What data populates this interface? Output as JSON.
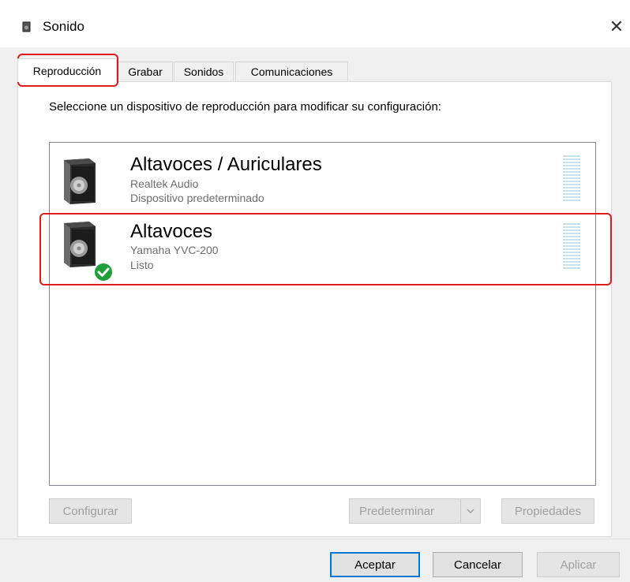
{
  "window": {
    "title": "Sonido",
    "close_glyph": "✕"
  },
  "tabs": [
    {
      "label": "Reproducción",
      "active": true
    },
    {
      "label": "Grabar",
      "active": false
    },
    {
      "label": "Sonidos",
      "active": false
    },
    {
      "label": "Comunicaciones",
      "active": false
    }
  ],
  "playback": {
    "instruction": "Seleccione un dispositivo de reproducción para modificar su configuración:",
    "devices": [
      {
        "name": "Altavoces / Auriculares",
        "driver": "Realtek Audio",
        "status": "Dispositivo predeterminado",
        "default": true,
        "icon": "speaker-icon"
      },
      {
        "name": "Altavoces",
        "driver": "Yamaha YVC-200",
        "status": "Listo",
        "default": false,
        "icon": "speaker-icon",
        "badge": "check-icon"
      }
    ]
  },
  "buttons": {
    "configure": "Configurar",
    "set_default": "Predeterminar",
    "properties": "Propiedades",
    "ok": "Aceptar",
    "cancel": "Cancelar",
    "apply": "Aplicar"
  },
  "colors": {
    "highlight": "#e01b1b",
    "accent": "#0078d7",
    "check_green": "#1f9e3a",
    "meter": "#c7e0ea"
  }
}
